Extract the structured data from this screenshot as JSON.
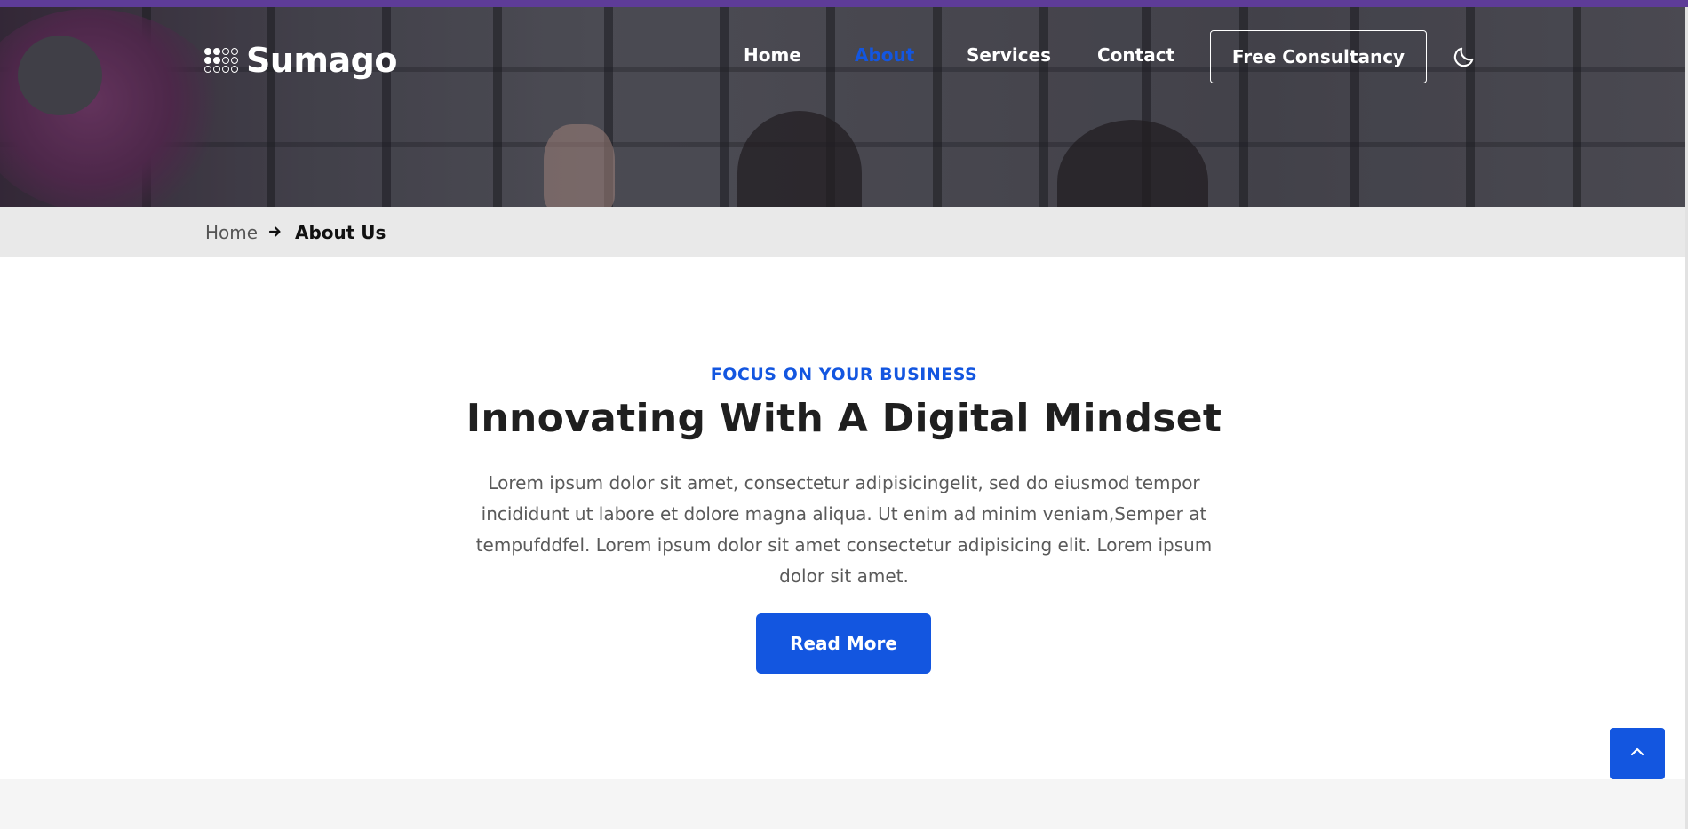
{
  "brand": {
    "name": "Sumago",
    "logo_icon": "dots-grid-logo"
  },
  "nav": {
    "items": [
      {
        "label": "Home",
        "active": false
      },
      {
        "label": "About",
        "active": true
      },
      {
        "label": "Services",
        "active": false
      },
      {
        "label": "Contact",
        "active": false
      }
    ],
    "cta_label": "Free Consultancy",
    "theme_toggle_icon": "moon-icon"
  },
  "breadcrumb": {
    "home": "Home",
    "separator_icon": "arrow-right-icon",
    "current": "About Us"
  },
  "intro": {
    "eyebrow": "FOCUS ON YOUR BUSINESS",
    "title": "Innovating With A Digital Mindset",
    "description": "Lorem ipsum dolor sit amet, consectetur adipisicingelit, sed do eiusmod tempor incididunt ut labore et dolore magna aliqua. Ut enim ad minim veniam,Semper at tempufddfel. Lorem ipsum dolor sit amet consectetur adipisicing elit. Lorem ipsum dolor sit amet.",
    "button_label": "Read More"
  },
  "scroll_top_icon": "chevron-up-icon",
  "colors": {
    "accent": "#1356e0",
    "top_bar": "#5e3c98",
    "breadcrumb_bg": "#e9e9e9",
    "heading": "#1f1f1f",
    "body_text": "#5a5a5a"
  }
}
